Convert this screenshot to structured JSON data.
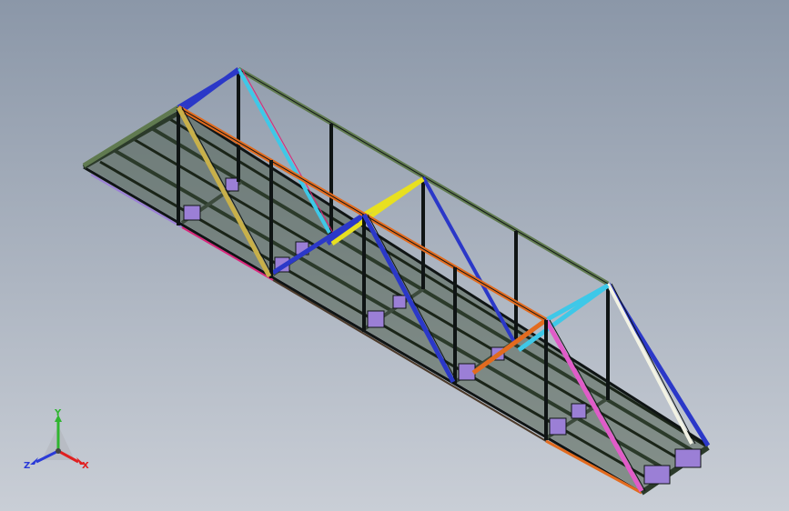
{
  "view": {
    "background_top": "#8b97a8",
    "background_bottom": "#c9ced6"
  },
  "model": {
    "outline_color": "#0f1414",
    "frame_color": "#3c4a3c",
    "member_colors": {
      "top_chord": "#607a50",
      "orange": "#e26b1f",
      "blue": "#2b38c8",
      "yellow": "#e8e020",
      "cyan": "#3ec8e8",
      "pink": "#e05cc8",
      "khaki": "#c8b04a",
      "white": "#f2f2e4",
      "magenta": "#d8267a",
      "gusset": "#9b7fd6",
      "deck": "#4c5c4c"
    }
  },
  "triad": {
    "y_label": "Y",
    "x_label": "X",
    "z_label": "Z",
    "y_color": "#2fb52f",
    "x_color": "#e02020",
    "z_color": "#2a3ad8",
    "cone_color": "#b8bcc4"
  }
}
